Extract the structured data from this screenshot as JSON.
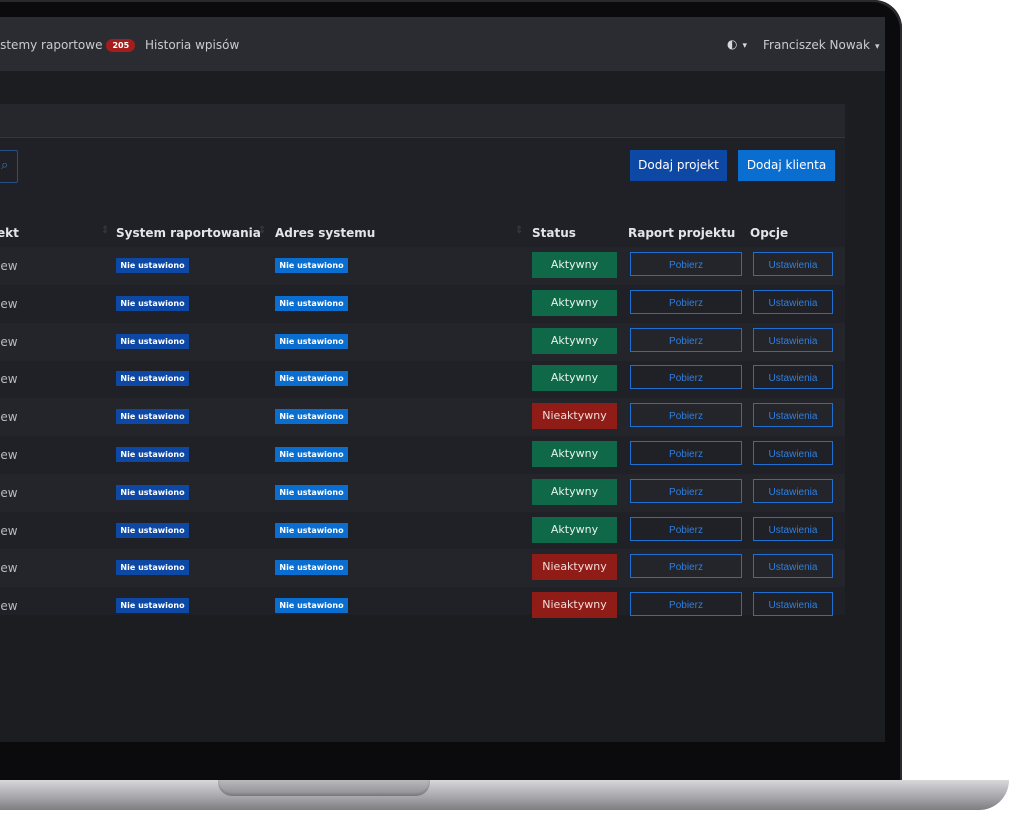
{
  "navbar": {
    "reports_label": "ystemy raportowe",
    "reports_badge": "205",
    "history_label": "Historia wpisów",
    "theme_icon": "contrast-icon",
    "user_name": "Franciszek Nowak"
  },
  "toolbar": {
    "add_project_label": "Dodaj projekt",
    "add_client_label": "Dodaj klienta"
  },
  "table": {
    "headers": {
      "project": "ekt",
      "system": "System raportowania",
      "address": "Adres systemu",
      "status": "Status",
      "report": "Raport projektu",
      "options": "Opcje"
    },
    "rows": [
      {
        "name": "iew",
        "system": "Nie ustawiono",
        "address": "Nie ustawiono",
        "status": "Aktywny",
        "report": "Pobierz",
        "options": "Ustawienia"
      },
      {
        "name": "iew",
        "system": "Nie ustawiono",
        "address": "Nie ustawiono",
        "status": "Aktywny",
        "report": "Pobierz",
        "options": "Ustawienia"
      },
      {
        "name": "iew",
        "system": "Nie ustawiono",
        "address": "Nie ustawiono",
        "status": "Aktywny",
        "report": "Pobierz",
        "options": "Ustawienia"
      },
      {
        "name": "iew",
        "system": "Nie ustawiono",
        "address": "Nie ustawiono",
        "status": "Aktywny",
        "report": "Pobierz",
        "options": "Ustawienia"
      },
      {
        "name": "iew",
        "system": "Nie ustawiono",
        "address": "Nie ustawiono",
        "status": "Nieaktywny",
        "report": "Pobierz",
        "options": "Ustawienia"
      },
      {
        "name": "iew",
        "system": "Nie ustawiono",
        "address": "Nie ustawiono",
        "status": "Aktywny",
        "report": "Pobierz",
        "options": "Ustawienia"
      },
      {
        "name": "iew",
        "system": "Nie ustawiono",
        "address": "Nie ustawiono",
        "status": "Aktywny",
        "report": "Pobierz",
        "options": "Ustawienia"
      },
      {
        "name": "iew",
        "system": "Nie ustawiono",
        "address": "Nie ustawiono",
        "status": "Aktywny",
        "report": "Pobierz",
        "options": "Ustawienia"
      },
      {
        "name": "iew",
        "system": "Nie ustawiono",
        "address": "Nie ustawiono",
        "status": "Nieaktywny",
        "report": "Pobierz",
        "options": "Ustawienia"
      },
      {
        "name": "iew",
        "system": "Nie ustawiono",
        "address": "Nie ustawiono",
        "status": "Nieaktywny",
        "report": "Pobierz",
        "options": "Ustawienia"
      }
    ]
  },
  "colors": {
    "primary": "#0d48a5",
    "accent": "#0a6ed1",
    "active": "#0f6848",
    "inactive": "#8f1c16",
    "badge": "#a41d1d"
  }
}
